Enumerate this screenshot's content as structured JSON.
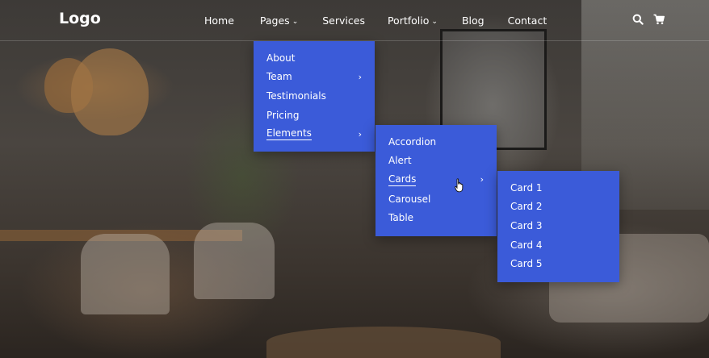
{
  "logo": "Logo",
  "nav": [
    {
      "label": "Home",
      "has_dropdown": false
    },
    {
      "label": "Pages",
      "has_dropdown": true
    },
    {
      "label": "Services",
      "has_dropdown": false
    },
    {
      "label": "Portfolio",
      "has_dropdown": true
    },
    {
      "label": "Blog",
      "has_dropdown": false
    },
    {
      "label": "Contact",
      "has_dropdown": false
    }
  ],
  "header_icons": [
    "search-icon",
    "cart-icon"
  ],
  "pages_menu": {
    "items": [
      {
        "label": "About"
      },
      {
        "label": "Team",
        "submenu": true
      },
      {
        "label": "Testimonials"
      },
      {
        "label": "Pricing"
      },
      {
        "label": "Elements",
        "submenu": true,
        "active": true
      }
    ]
  },
  "elements_menu": {
    "items": [
      {
        "label": "Accordion"
      },
      {
        "label": "Alert"
      },
      {
        "label": "Cards",
        "submenu": true,
        "active": true
      },
      {
        "label": "Carousel"
      },
      {
        "label": "Table"
      }
    ]
  },
  "cards_menu": {
    "items": [
      {
        "label": "Card 1"
      },
      {
        "label": "Card 2"
      },
      {
        "label": "Card 3"
      },
      {
        "label": "Card 4"
      },
      {
        "label": "Card 5"
      }
    ]
  },
  "colors": {
    "menu_bg": "#3b5bd9",
    "text": "#ffffff"
  }
}
